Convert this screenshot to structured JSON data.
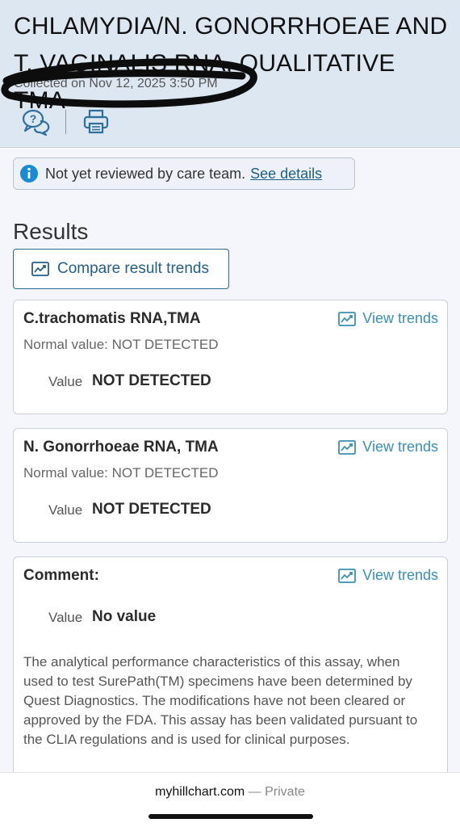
{
  "header": {
    "title": "CHLAMYDIA/N. GONORRHOEAE AND T. VAGINALIS RNA, QUALITATIVE TMA",
    "collected": "Collected on Nov 12, 2025 3:50 PM",
    "icons": [
      "help-chat-icon",
      "print-icon"
    ]
  },
  "notice": {
    "text": "Not yet reviewed by care team.",
    "link": "See details",
    "icon": "info-icon",
    "color": "#1a8ad4"
  },
  "results": {
    "heading": "Results",
    "compare_label": "Compare result trends",
    "cards": [
      {
        "name": "C.trachomatis RNA,TMA",
        "trends_label": "View trends",
        "normal": "Normal value: NOT DETECTED",
        "value_label": "Value",
        "value": "NOT DETECTED"
      },
      {
        "name": "N. Gonorrhoeae RNA, TMA",
        "trends_label": "View trends",
        "normal": "Normal value: NOT DETECTED",
        "value_label": "Value",
        "value": "NOT DETECTED"
      },
      {
        "name": "Comment:",
        "trends_label": "View trends",
        "value_label": "Value",
        "value": "No value",
        "comment": "The analytical performance characteristics of this assay, when used to test SurePath(TM) specimens have been determined by Quest Diagnostics. The modifications have not been cleared or approved by the FDA. This assay has been validated pursuant to the CLIA regulations and is used for clinical purposes."
      }
    ]
  },
  "footer": {
    "url": "myhillchart.com",
    "privacy": "— Private"
  },
  "colors": {
    "header_bg": "#dde7f2",
    "link": "#1d5f8a",
    "trends": "#3a8fb4",
    "button_border": "#2d6a92"
  }
}
